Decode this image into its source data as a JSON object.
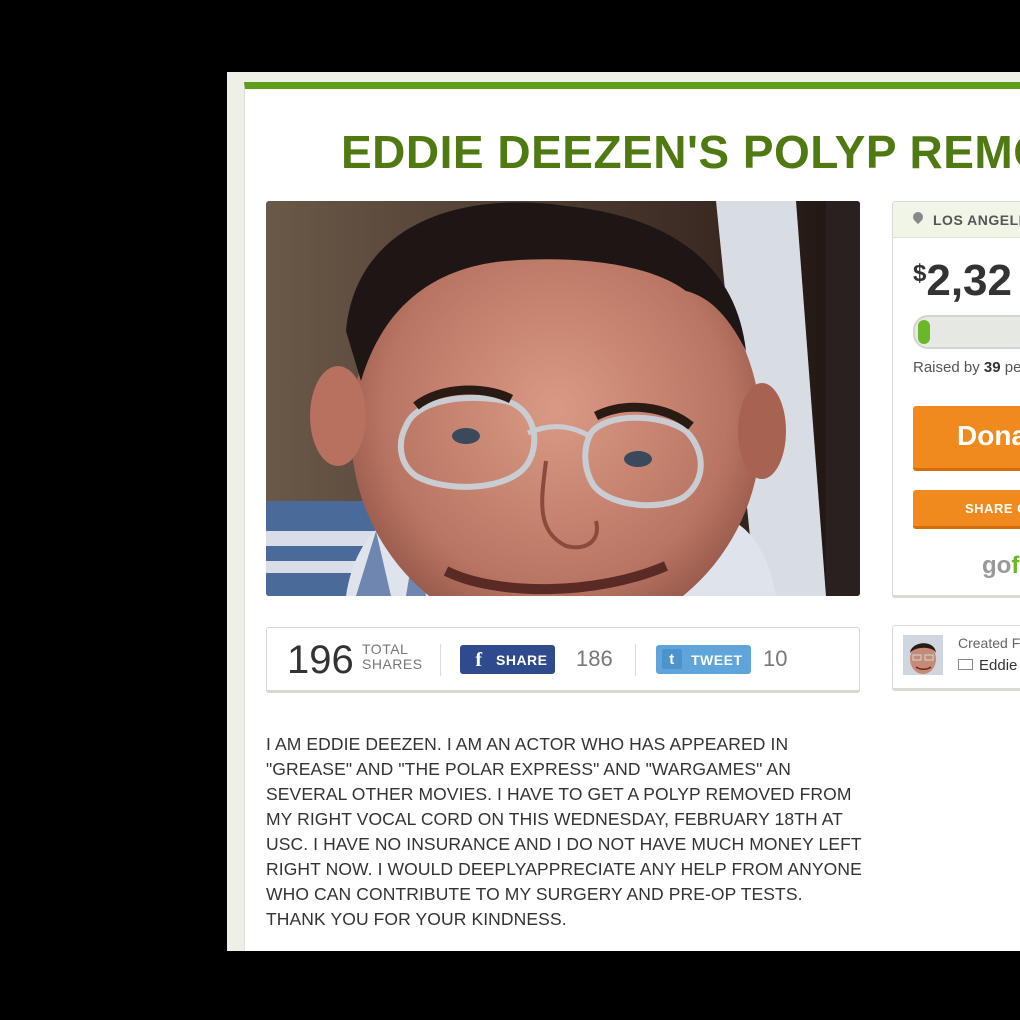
{
  "campaign": {
    "title": "EDDIE DEEZEN'S POLYP REMO",
    "location": "LOS ANGELE",
    "amount_currency": "$",
    "amount_value": "2,32",
    "progress_fraction": 0.04,
    "raised_prefix": "Raised by",
    "raised_count": "39",
    "raised_suffix": "peo",
    "donate_label": "Dona",
    "share_label": "SHARE C",
    "logo_go": "go",
    "logo_f": "f"
  },
  "shares": {
    "total": "196",
    "total_label_line1": "TOTAL",
    "total_label_line2": "SHARES",
    "facebook_label": "SHARE",
    "facebook_icon": "f",
    "facebook_count": "186",
    "twitter_label": "TWEET",
    "twitter_icon": "t",
    "twitter_count": "10"
  },
  "story": "I AM EDDIE DEEZEN. I AM AN ACTOR WHO HAS APPEARED IN \"GREASE\" AND \"THE POLAR EXPRESS\" AND \"WARGAMES\" AN SEVERAL OTHER MOVIES. I HAVE TO GET A POLYP REMOVED FROM MY RIGHT VOCAL CORD ON THIS WEDNESDAY, FEBRUARY 18TH AT USC. I HAVE NO INSURANCE AND I DO NOT HAVE MUCH MONEY LEFT RIGHT NOW. I WOULD DEEPLYAPPRECIATE ANY HELP FROM ANYONE WHO CAN CONTRIBUTE TO MY SURGERY AND PRE-OP TESTS. THANK YOU FOR YOUR KINDNESS.",
  "creator": {
    "created_label": "Created Fe",
    "name": "Eddie"
  },
  "colors": {
    "brand_green": "#5e9e1a",
    "title_green": "#4f7a12",
    "donate_orange": "#f08a1e",
    "facebook_blue": "#2f4b8d",
    "twitter_blue": "#5fa4da"
  },
  "icons": [
    "location-pin-icon",
    "facebook-icon",
    "twitter-icon",
    "mail-icon"
  ]
}
